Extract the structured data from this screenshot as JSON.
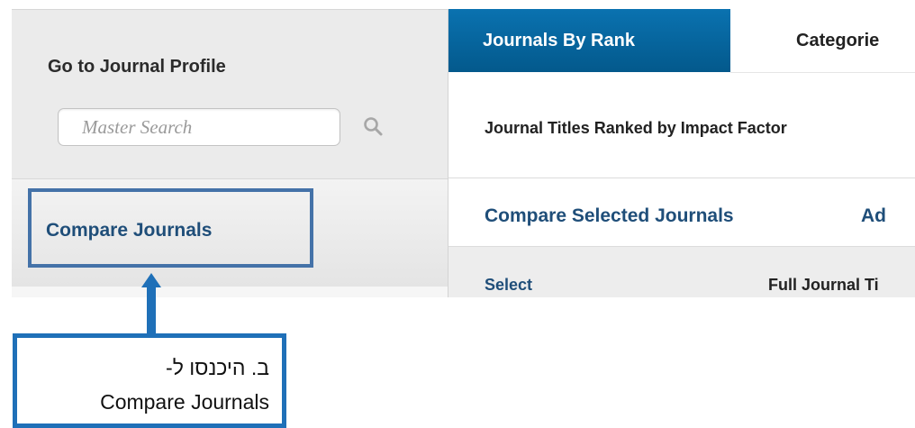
{
  "sidebar": {
    "profile_title": "Go to Journal Profile",
    "search_placeholder": "Master Search",
    "search_icon": "search-icon",
    "compare_link": "Compare Journals"
  },
  "tabs": [
    {
      "label": "Journals By Rank",
      "active": true
    },
    {
      "label": "Categorie",
      "active": false
    }
  ],
  "main": {
    "ranked_title": "Journal Titles Ranked by Impact Factor",
    "compare_selected": "Compare Selected Journals",
    "add_link": "Ad",
    "columns": [
      "Select",
      "Full Journal Ti"
    ]
  },
  "annotation": {
    "line1": "ב. היכנסו ל-",
    "line2": "Compare Journals"
  },
  "colors": {
    "tab_active": "#0a6aa5",
    "link": "#1f4e79",
    "annotation": "#1f70b8",
    "highlight": "#4472a8"
  }
}
